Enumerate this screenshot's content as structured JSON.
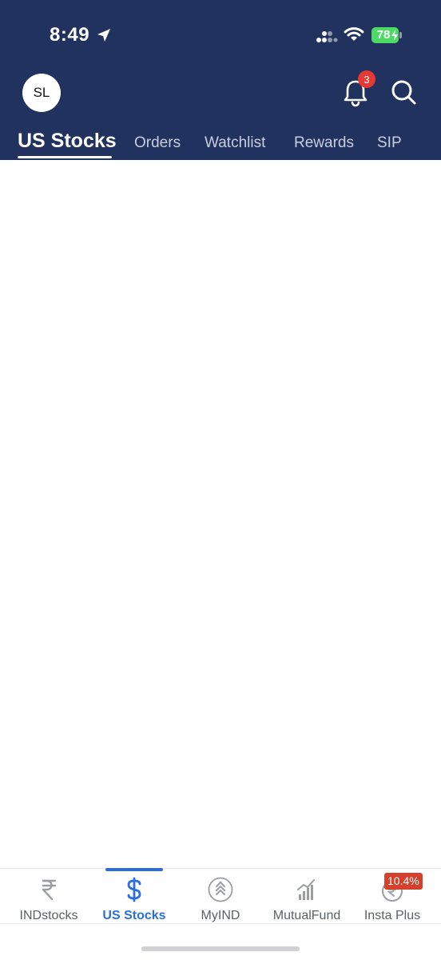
{
  "status_bar": {
    "time": "8:49",
    "battery": "78",
    "icons": [
      "location-arrow-icon",
      "signal-icon",
      "wifi-icon",
      "battery-charging-icon"
    ]
  },
  "header": {
    "avatar_initials": "SL",
    "notification_count": "3",
    "icons": [
      "bell-icon",
      "search-icon"
    ],
    "background_color": "#22325e"
  },
  "tabs": [
    {
      "label": "US Stocks",
      "active": true
    },
    {
      "label": "Orders",
      "active": false
    },
    {
      "label": "Watchlist",
      "active": false
    },
    {
      "label": "Rewards",
      "active": false
    },
    {
      "label": "SIP",
      "active": false
    }
  ],
  "bottom_nav": {
    "items": [
      {
        "label": "INDstocks",
        "icon": "rupee-icon",
        "active": false
      },
      {
        "label": "US Stocks",
        "icon": "dollar-icon",
        "active": true
      },
      {
        "label": "MyIND",
        "icon": "chevrons-up-icon",
        "active": false
      },
      {
        "label": "MutualFund",
        "icon": "bar-chart-icon",
        "active": false
      },
      {
        "label": "Insta Plus",
        "icon": "rupee-coin-icon",
        "active": false
      }
    ],
    "promo_badge": "10.4%",
    "accent_color": "#2b6ee0"
  }
}
